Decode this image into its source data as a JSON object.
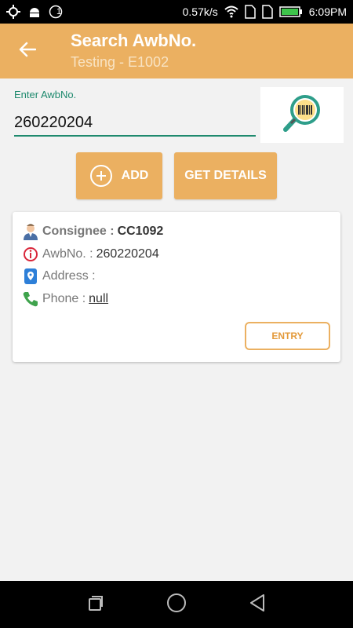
{
  "status_bar": {
    "speed": "0.57k/s",
    "time": "6:09PM",
    "notification_count": "1"
  },
  "toolbar": {
    "title": "Search AwbNo.",
    "subtitle": "Testing - E1002"
  },
  "search": {
    "label": "Enter AwbNo.",
    "value": "260220204"
  },
  "actions": {
    "add_label": "ADD",
    "get_details_label": "GET DETAILS"
  },
  "card": {
    "consignee_label": "Consignee :",
    "consignee_value": "CC1092",
    "awb_label": "AwbNo. :",
    "awb_value": "260220204",
    "address_label": "Address :",
    "address_value": "",
    "phone_label": "Phone :",
    "phone_value": "null",
    "entry_label": "ENTRY"
  },
  "colors": {
    "accent": "#ebb061",
    "field_green": "#1f8a6e",
    "entry_text": "#e39a3b"
  },
  "icons": {
    "back": "arrow-left-icon",
    "scan": "barcode-magnifier-icon",
    "consignee": "person-icon",
    "awb": "info-icon",
    "address": "location-pin-icon",
    "phone": "phone-icon"
  }
}
